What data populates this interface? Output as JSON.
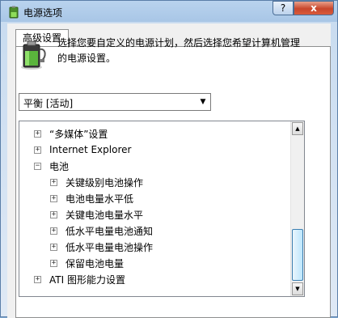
{
  "window": {
    "title": "电源选项"
  },
  "titlebar": {
    "help_label": "?",
    "close_label": "x"
  },
  "tabs": [
    {
      "label": "高级设置"
    }
  ],
  "description": "选择您要自定义的电源计划，然后选择您希望计算机管理的电源设置。",
  "plan_select": {
    "value": "平衡 [活动]"
  },
  "tree": {
    "items": [
      {
        "label": "“多媒体”设置",
        "expander": "+"
      },
      {
        "label": "Internet Explorer",
        "expander": "+"
      },
      {
        "label": "电池",
        "expander": "−"
      },
      {
        "label": "关键级别电池操作",
        "expander": "+"
      },
      {
        "label": "电池电量水平低",
        "expander": "+"
      },
      {
        "label": "关键电池电量水平",
        "expander": "+"
      },
      {
        "label": "低水平电量电池通知",
        "expander": "+"
      },
      {
        "label": "低水平电量电池操作",
        "expander": "+"
      },
      {
        "label": "保留电池电量",
        "expander": "+"
      },
      {
        "label": "ATI 图形能力设置",
        "expander": "+"
      }
    ]
  },
  "colors": {
    "accent": "#3c7fb1",
    "close": "#c8462c",
    "battery": "#5ab43c"
  },
  "icons": {
    "title": "power-options-icon",
    "panel": "battery-icon"
  }
}
